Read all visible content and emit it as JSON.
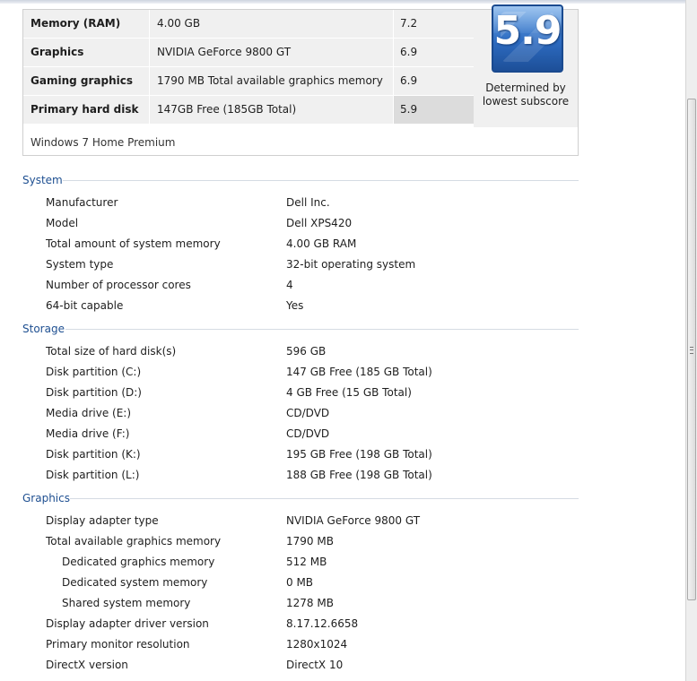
{
  "score_table": {
    "rows": [
      {
        "component": "Memory (RAM)",
        "description": "4.00 GB",
        "subscore": "7.2"
      },
      {
        "component": "Graphics",
        "description": "NVIDIA GeForce 9800 GT",
        "subscore": "6.9"
      },
      {
        "component": "Gaming graphics",
        "description": "1790 MB Total available graphics memory",
        "subscore": "6.9"
      },
      {
        "component": "Primary hard disk",
        "description": "147GB Free (185GB Total)",
        "subscore": "5.9"
      }
    ],
    "base_score": "5.9",
    "base_caption_1": "Determined by",
    "base_caption_2": "lowest subscore",
    "edition": "Windows 7 Home Premium"
  },
  "system": {
    "title": "System",
    "rows": [
      {
        "label": "Manufacturer",
        "value": "Dell Inc."
      },
      {
        "label": "Model",
        "value": "Dell XPS420"
      },
      {
        "label": "Total amount of system memory",
        "value": "4.00 GB RAM"
      },
      {
        "label": "System type",
        "value": "32-bit operating system"
      },
      {
        "label": "Number of processor cores",
        "value": "4"
      },
      {
        "label": "64-bit capable",
        "value": "Yes"
      }
    ]
  },
  "storage": {
    "title": "Storage",
    "rows": [
      {
        "label": "Total size of hard disk(s)",
        "value": "596 GB"
      },
      {
        "label": "Disk partition (C:)",
        "value": "147 GB Free (185 GB Total)"
      },
      {
        "label": "Disk partition (D:)",
        "value": "4 GB Free (15 GB Total)"
      },
      {
        "label": "Media drive (E:)",
        "value": "CD/DVD"
      },
      {
        "label": "Media drive (F:)",
        "value": "CD/DVD"
      },
      {
        "label": "Disk partition (K:)",
        "value": "195 GB Free (198 GB Total)"
      },
      {
        "label": "Disk partition (L:)",
        "value": "188 GB Free (198 GB Total)"
      }
    ]
  },
  "graphics": {
    "title": "Graphics",
    "rows": [
      {
        "label": "Display adapter type",
        "value": "NVIDIA GeForce 9800 GT"
      },
      {
        "label": "Total available graphics memory",
        "value": "1790 MB"
      },
      {
        "label": "Dedicated graphics memory",
        "value": "512 MB"
      },
      {
        "label": "Dedicated system memory",
        "value": "0 MB"
      },
      {
        "label": "Shared system memory",
        "value": "1278 MB"
      },
      {
        "label": "Display adapter driver version",
        "value": "8.17.12.6658"
      },
      {
        "label": "Primary monitor resolution",
        "value": "1280x1024"
      },
      {
        "label": "DirectX version",
        "value": "DirectX 10"
      }
    ]
  }
}
